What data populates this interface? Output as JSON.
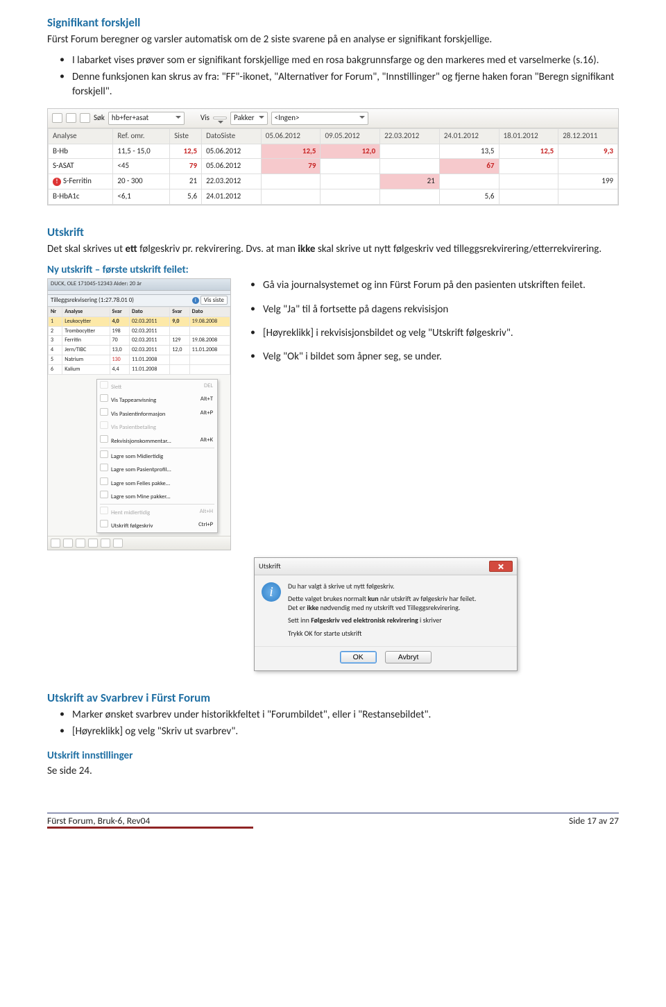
{
  "sec1": {
    "heading": "Signifikant forskjell",
    "intro": "Fürst Forum beregner og varsler automatisk om de 2 siste svarene på en analyse er signifikant forskjellige.",
    "b1": "I labarket vises prøver som er signifikant forskjellige med en rosa bakgrunnsfarge og den markeres med et varselmerke (s.16).",
    "b2": "Denne funksjonen kan skrus av fra: \"FF\"-ikonet, \"Alternativer for Forum\", \"Innstillinger\" og fjerne haken foran \"Beregn signifikant forskjell\"."
  },
  "shot1": {
    "toolbar": {
      "sok_label": "Søk",
      "sok_value": "hb+fer+asat",
      "vis_label": "Vis",
      "pakker_btn": "Pakker",
      "pakker_value": "<Ingen>"
    },
    "headers": [
      "Analyse",
      "Ref. omr.",
      "Siste",
      "DatoSiste",
      "05.06.2012",
      "09.05.2012",
      "22.03.2012",
      "24.01.2012",
      "18.01.2012",
      "28.12.2011"
    ],
    "rows": [
      {
        "a": "B-Hb",
        "r": "11,5 - 15,0",
        "s": "12,5",
        "sred": true,
        "d": "05.06.2012",
        "c": [
          "12,5",
          "12,0",
          "",
          "13,5",
          "12,5",
          "9,3"
        ],
        "cred": [
          true,
          true,
          false,
          false,
          true,
          true
        ],
        "pink": [
          0,
          1
        ]
      },
      {
        "a": "S-ASAT",
        "r": "<45",
        "s": "79",
        "sred": true,
        "d": "05.06.2012",
        "c": [
          "79",
          "",
          "",
          "67",
          "",
          ""
        ],
        "cred": [
          true,
          false,
          false,
          true,
          false,
          false
        ],
        "pink": [
          0,
          3
        ]
      },
      {
        "a": "S-Ferritin",
        "warn": true,
        "r": "20 - 300",
        "s": "21",
        "sred": false,
        "d": "22.03.2012",
        "c": [
          "",
          "",
          "21",
          "",
          "",
          "199"
        ],
        "cred": [
          false,
          false,
          false,
          false,
          false,
          false
        ],
        "pink": [
          2
        ]
      },
      {
        "a": "B-HbA1c",
        "r": "<6,1",
        "s": "5,6",
        "sred": false,
        "d": "24.01.2012",
        "c": [
          "",
          "",
          "",
          "5,6",
          "",
          ""
        ],
        "cred": [
          false,
          false,
          false,
          false,
          false,
          false
        ],
        "pink": []
      }
    ]
  },
  "sec2": {
    "heading": "Utskrift",
    "p1_a": "Det skal skrives ut ",
    "p1_b": "ett",
    "p1_c": " følgeskriv pr. rekvirering. Dvs. at man ",
    "p1_d": "ikke",
    "p1_e": " skal skrive ut nytt følgeskriv ved tilleggsrekvirering/etterrekvirering.",
    "sub": "Ny utskrift – første utskrift feilet:"
  },
  "shot2": {
    "headerline": "DUCK, OLE 171045-12343 Alder: 20 år",
    "sub_title": "Tilleggsrekvisering (1:27.78.01 0)",
    "sub_btn": "Vis siste",
    "cols": [
      "Nr",
      "Analyse",
      "Svar",
      "Dato",
      "Svar",
      "Dato"
    ],
    "rows": [
      [
        "1",
        "Leukocytter",
        "4,0",
        "02.03.2011",
        "9,0",
        "19.08.2008"
      ],
      [
        "2",
        "Trombocytter",
        "198",
        "02.03.2011",
        "",
        ""
      ],
      [
        "3",
        "Ferritin",
        "70",
        "02.03.2011",
        "129",
        "19.08.2008"
      ],
      [
        "4",
        "Jern/TIBC",
        "13,0",
        "02.03.2011",
        "12,0",
        "11.01.2008"
      ],
      [
        "5",
        "Natrium",
        "130",
        "11.01.2008",
        "",
        ""
      ],
      [
        "6",
        "Kalium",
        "4,4",
        "11.01.2008",
        "",
        ""
      ]
    ],
    "redrow": 4,
    "boldrow": 0,
    "menu": [
      {
        "label": "Slett",
        "sc": "DEL",
        "gray": true
      },
      {
        "label": "Vis Tappeanvisning",
        "sc": "Alt+T"
      },
      {
        "label": "Vis Pasientinformasjon",
        "sc": "Alt+P"
      },
      {
        "label": "Vis Pasientbetaling",
        "sc": "",
        "gray": true
      },
      {
        "label": "Rekvisisjonskommentar...",
        "sc": "Alt+K"
      },
      {
        "sep": true
      },
      {
        "label": "Lagre som Midlertidig",
        "sc": ""
      },
      {
        "label": "Lagre som Pasientprofil...",
        "sc": ""
      },
      {
        "label": "Lagre som Felles pakke...",
        "sc": ""
      },
      {
        "label": "Lagre som Mine pakker...",
        "sc": ""
      },
      {
        "sep": true
      },
      {
        "label": "Hent midlertidig",
        "sc": "Alt+H",
        "gray": true
      },
      {
        "label": "Utskrift følgeskriv",
        "sc": "Ctrl+P"
      }
    ]
  },
  "rightbul": {
    "b1": "Gå via journalsystemet og inn Fürst Forum på den pasienten utskriften feilet.",
    "b2": "Velg \"Ja\" til å fortsette på dagens rekvisisjon",
    "b3": "[Høyreklikk] i rekvisisjonsbildet og velg \"Utskrift følgeskriv\".",
    "b4": "Velg \"Ok\" i bildet som åpner seg, se under."
  },
  "shot3": {
    "title": "Utskrift",
    "l1": "Du har valgt å skrive ut nytt følgeskriv.",
    "l2a": "Dette valget brukes normalt ",
    "l2b": "kun",
    "l2c": " når utskrift av følgeskriv har feilet.",
    "l3a": "Det er ",
    "l3b": "ikke",
    "l3c": " nødvendig med ny utskrift ved Tilleggsrekvirering.",
    "l4a": "Sett inn ",
    "l4b": "Følgeskriv ved elektronisk rekvirering",
    "l4c": " i skriver",
    "l5": "Trykk OK for starte utskrift",
    "ok": "OK",
    "cancel": "Avbryt"
  },
  "sec3": {
    "heading": "Utskrift av Svarbrev i Fürst Forum",
    "b1": "Marker ønsket svarbrev under historikkfeltet i \"Forumbildet\", eller i \"Restansebildet\".",
    "b2": "[Høyreklikk] og velg \"Skriv ut svarbrev\".",
    "sub": "Utskrift innstillinger",
    "p": "Se side 24."
  },
  "foot": {
    "left": "Fürst Forum, Bruk-6, Rev04",
    "right": "Side 17 av 27"
  }
}
